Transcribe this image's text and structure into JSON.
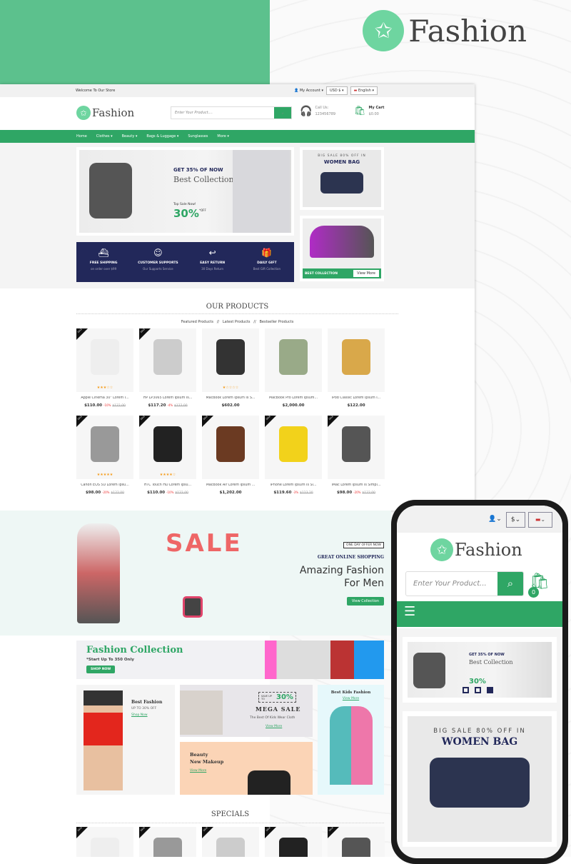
{
  "brand": {
    "name": "Fashion",
    "accent": "#2fa665",
    "navy": "#22285a"
  },
  "topbar": {
    "welcome": "Welcome To Our Store",
    "account": "My Account",
    "currency": "USD $",
    "language": "English"
  },
  "header": {
    "search_placeholder": "Enter Your Product....",
    "call_label": "Call Us:",
    "phone": "123456789",
    "cart_label": "My Cart",
    "cart_total": "$0.00",
    "cart_count": "0"
  },
  "nav": [
    "Home",
    "Clothes ▾",
    "Beauty ▾",
    "Bags & Luggage ▾",
    "Sunglasses",
    "More ▾"
  ],
  "hero": {
    "headline": "GET 35% OF NOW",
    "title": "Best Collection",
    "top_sale": "Top Sale Now!",
    "percent": "30%",
    "off": "*OFF"
  },
  "side_banner": {
    "small": "BIG SALE 80% OFF IN",
    "big": "WOMEN BAG",
    "best_collection": "BEST COLLECTION",
    "view_more": "View More"
  },
  "services": [
    {
      "icon": "ship-icon",
      "glyph": "⛴",
      "title": "FREE SHIPPING",
      "sub": "on order over $99"
    },
    {
      "icon": "support-icon",
      "glyph": "☺",
      "title": "CUSTOMER SUPPORTS",
      "sub": "Our Supports Service"
    },
    {
      "icon": "return-icon",
      "glyph": "↩",
      "title": "EASY RETURN",
      "sub": "30 Days Return"
    },
    {
      "icon": "gift-icon",
      "glyph": "🎁",
      "title": "DAILY GIFT",
      "sub": "Best Gift Collection"
    }
  ],
  "products_section": {
    "title": "OUR PRODUCTS",
    "tabs": [
      "Featured Products",
      "Latest Products",
      "Bestseller Products"
    ],
    "sep": "//",
    "badge": "SALE"
  },
  "products": [
    {
      "name": "Apple Cinema 30\" Lorem I...",
      "price": "$110.00",
      "discount": "-10%",
      "old": "$122.00",
      "rating": 3,
      "sale": true
    },
    {
      "name": "HP LP3065 Lorem Ipsum Is...",
      "price": "$117.20",
      "discount": "-4%",
      "old": "$122.00",
      "rating": 0,
      "sale": true
    },
    {
      "name": "MacBook Lorem Ipsum Is S...",
      "price": "$602.00",
      "rating": 1,
      "sale": false
    },
    {
      "name": "MacBook Pro Lorem Ipsum...",
      "price": "$2,000.00",
      "rating": 0,
      "sale": false
    },
    {
      "name": "iPod Classic Lorem Ipsum I...",
      "price": "$122.00",
      "rating": 0,
      "sale": false
    },
    {
      "name": "Canon EOS 5D Lorem Ipsu...",
      "price": "$98.00",
      "discount": "-20%",
      "old": "$122.00",
      "rating": 5,
      "sale": true
    },
    {
      "name": "HTC Touch HD Lorem Ipsu...",
      "price": "$110.00",
      "discount": "-10%",
      "old": "$122.00",
      "rating": 4,
      "sale": true
    },
    {
      "name": "MacBook Air Lorem Ipsum ...",
      "price": "$1,202.00",
      "rating": 0,
      "sale": true
    },
    {
      "name": "iPhone Lorem Ipsum Is Si...",
      "price": "$119.60",
      "discount": "-3%",
      "old": "$123.20",
      "rating": 0,
      "sale": true
    },
    {
      "name": "iMac Lorem Ipsum Is Simpl...",
      "price": "$98.00",
      "discount": "-20%",
      "old": "$122.00",
      "rating": 0,
      "sale": true
    }
  ],
  "sale_banner": {
    "sale_word": "SALE",
    "offer": "ONE DAY OFFER NOW",
    "kicker": "GREAT ONLINE SHOPPING",
    "title1": "Amazing Fashion",
    "title2": "For Men",
    "button": "View Collection"
  },
  "collection": {
    "title": "Fashion Collection",
    "sub": "*Start Up To 350 Only",
    "button": "SHOP NOW"
  },
  "promos": {
    "best_fashion": {
      "title": "Best Fashion",
      "sub": "UP TO 30% OFF",
      "link": "Shop Now"
    },
    "mega": {
      "save": "SAVE UP TO",
      "percent": "30%",
      "title": "MEGA SALE",
      "sub": "The Best Of Kids Wear Cloth",
      "link": "View More"
    },
    "beauty": {
      "title1": "Beauty",
      "title2": "New Makeup",
      "link": "View More"
    },
    "kids": {
      "title": "Best Kids Fashion",
      "link": "View More"
    }
  },
  "specials": {
    "title": "SPECIALS"
  },
  "mobile": {
    "currency": "$",
    "search_placeholder": "Enter Your Product...",
    "cart_count": "0",
    "slides": 3,
    "active_slide": 3
  }
}
